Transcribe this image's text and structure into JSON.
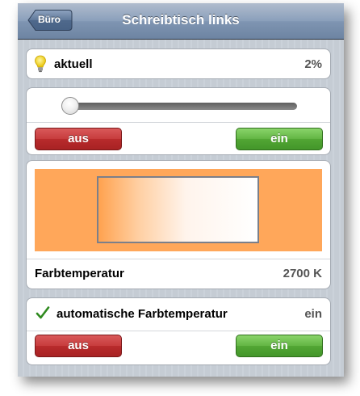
{
  "navbar": {
    "back_label": "Büro",
    "title": "Schreibtisch links"
  },
  "brightness": {
    "icon": "lightbulb-icon",
    "label": "aktuell",
    "value": "2%",
    "slider_fraction": 0.02,
    "off_label": "aus",
    "on_label": "ein"
  },
  "color_temperature": {
    "label": "Farbtemperatur",
    "value": "2700 K",
    "area_color": "#ffa75a"
  },
  "auto_temperature": {
    "icon": "checkmark-icon",
    "label": "automatische Farbtemperatur",
    "status": "ein",
    "off_label": "aus",
    "on_label": "ein"
  },
  "colors": {
    "navbar": "#7f95b2",
    "button_off": "#c73c3d",
    "button_on": "#62b543",
    "checkmark": "#2f8a1f"
  }
}
